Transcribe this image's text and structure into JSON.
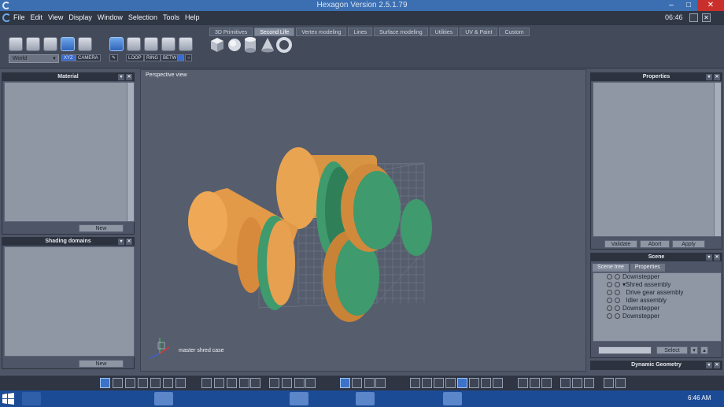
{
  "window": {
    "title": "Hexagon Version 2.5.1.79",
    "minimize": "–",
    "maximize": "□",
    "close": "✕"
  },
  "menu": {
    "items": [
      "File",
      "Edit",
      "View",
      "Display",
      "Window",
      "Selection",
      "Tools",
      "Help"
    ],
    "clock": "06:46"
  },
  "toolbar": {
    "tabs": [
      "3D Primitives",
      "Second Life",
      "Vertex modeling",
      "Lines",
      "Surface modeling",
      "Utilities",
      "UV & Paint",
      "Custom"
    ],
    "active_tab": "Second Life",
    "coord_dropdown": "World",
    "xyz_label": "XYZ",
    "camera_label": "CAMERA",
    "loop_label": "LOOP",
    "ring_label": "RING",
    "betw_label": "BETW"
  },
  "left_panels": {
    "material": {
      "title": "Material",
      "button": "New"
    },
    "shading": {
      "title": "Shading domains",
      "button": "New"
    }
  },
  "viewport": {
    "label": "Perspective view",
    "object_label": "master shred case"
  },
  "properties": {
    "title": "Properties",
    "buttons": [
      "Validate",
      "Abort",
      "Apply"
    ]
  },
  "scene": {
    "title": "Scene",
    "tabs": [
      "Scene tree",
      "Properties"
    ],
    "active_tab": "Scene tree",
    "items": [
      "Downstepper",
      "Shred assembly",
      "Drive gear assembly",
      "Idler assembly",
      "Downstepper",
      "Downstepper"
    ],
    "select_button": "Select"
  },
  "dynamic_geometry": {
    "title": "Dynamic Geometry"
  },
  "taskbar": {
    "time": "6:46 AM"
  },
  "colors": {
    "titlebar": "#3b6fb2",
    "accent": "#3c73c8",
    "gear_green": "#3f9a6d",
    "cylinder_orange": "#e9a452",
    "taskbar": "#1c4b96"
  }
}
